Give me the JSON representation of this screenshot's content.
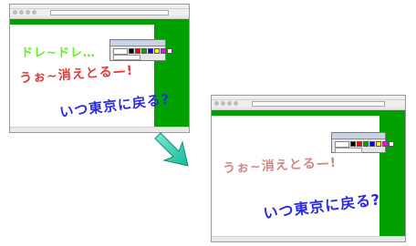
{
  "window_before": {
    "handwriting": [
      {
        "text": "ドレ~ドレ…",
        "color": "#66ee22"
      },
      {
        "text": "うぉ~消えとる—!",
        "color": "#e23a3a"
      },
      {
        "text": "いつ東京に戻る?",
        "color": "#2a2ae0"
      }
    ]
  },
  "window_after": {
    "handwriting": [
      {
        "text": "うぉ~消えとる—!",
        "color": "#cf8888"
      },
      {
        "text": "いつ東京に戻る?",
        "color": "#2a2ae0"
      }
    ]
  },
  "palette_colors": [
    "#000000",
    "#ff0000",
    "#00aa00",
    "#0000ff",
    "#ffff00",
    "#ff00ff",
    "#ffffff"
  ],
  "arrow_icon": "down-right-arrow-icon"
}
